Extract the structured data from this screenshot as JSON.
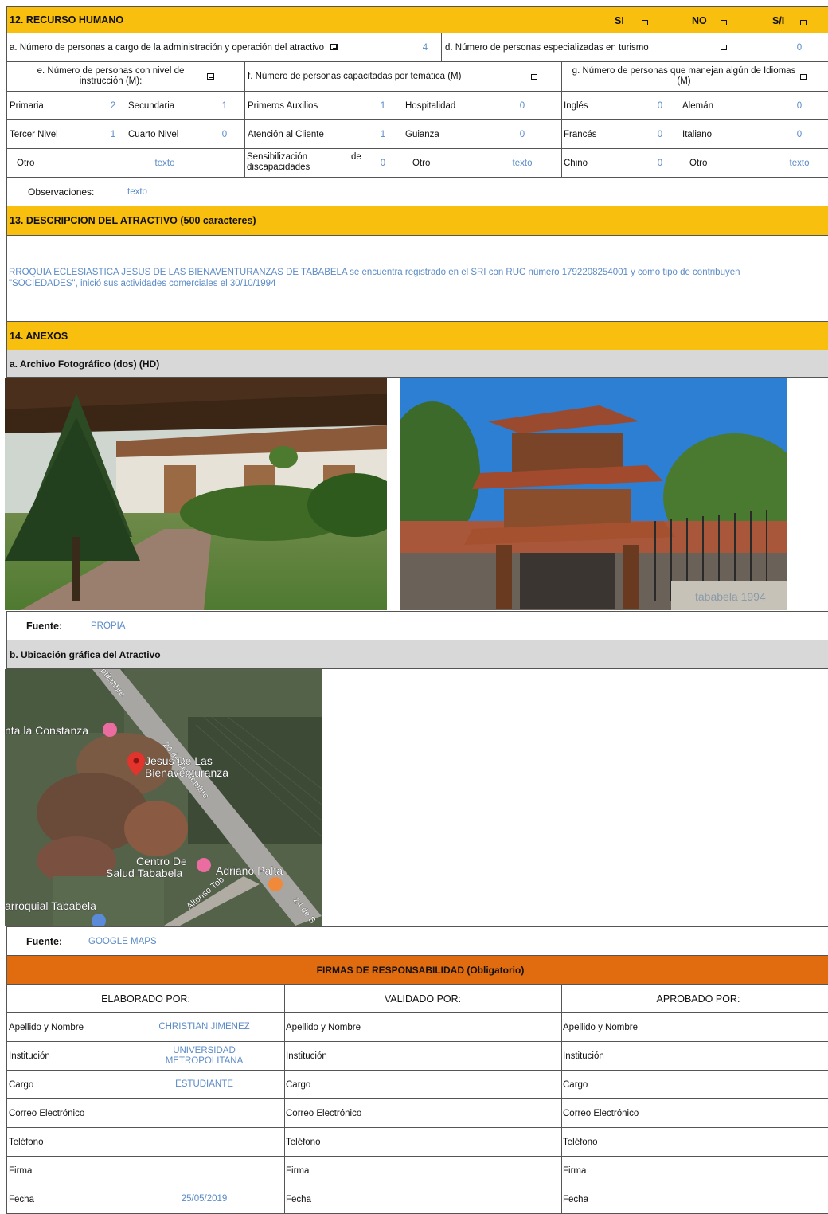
{
  "s12": {
    "title": "12. RECURSO HUMANO",
    "si": "SI",
    "no": "NO",
    "si_na": "S/I",
    "a_label": "a. Número de personas a cargo de la administración y operación del atractivo",
    "a_value": "4",
    "d_label": "d. Número de personas especializadas en turismo",
    "d_value": "0",
    "e_label": "e. Número de personas con nivel de instrucción (M):",
    "f_label": "f. Número de personas capacitadas por temática (M)",
    "g_label": "g. Número de personas que manejan algún de Idiomas (M)",
    "rows": [
      [
        [
          "Primaria",
          "2"
        ],
        [
          "Secundaria",
          "1"
        ],
        [
          "Primeros Auxilios",
          "1"
        ],
        [
          "Hospitalidad",
          "0"
        ],
        [
          "Inglés",
          "0"
        ],
        [
          "Alemán",
          "0"
        ]
      ],
      [
        [
          "Tercer Nivel",
          "1"
        ],
        [
          "Cuarto Nivel",
          "0"
        ],
        [
          "Atención al Cliente",
          "1"
        ],
        [
          "Guianza",
          "0"
        ],
        [
          "Francés",
          "0"
        ],
        [
          "Italiano",
          "0"
        ]
      ]
    ],
    "row3": {
      "otro1": "Otro",
      "otro1_val": "texto",
      "sens_a": "Sensibilización",
      "sens_de": "de",
      "sens_b": "discapacidades",
      "sens_val": "0",
      "otro2": "Otro",
      "otro2_val": "texto",
      "chino": "Chino",
      "chino_val": "0",
      "otro3": "Otro",
      "otro3_val": "texto"
    },
    "obs_label": "Observaciones:",
    "obs_value": "texto"
  },
  "s13": {
    "title": "13. DESCRIPCION DEL ATRACTIVO (500 caracteres)",
    "line1": "RROQUIA ECLESIASTICA JESUS DE LAS BIENAVENTURANZAS DE TABABELA se encuentra registrado en el SRI con RUC número 1792208254001 y como tipo de contribuyen",
    "line2": "\"SOCIEDADES\", inició sus actividades comerciales el 30/10/1994"
  },
  "s14": {
    "title": "14. ANEXOS",
    "a_title": "a. Archivo Fotográfico (dos) (HD)",
    "fuente_label": "Fuente:",
    "fuente_a": "PROPIA",
    "b_title": "b. Ubicación gráfica del Atractivo",
    "fuente_b": "GOOGLE MAPS",
    "map_labels": {
      "street_top": "ptiembre",
      "quinta": "nta la Constanza",
      "pin1": "Jesus De Las",
      "pin2": "Bienaventuranza",
      "street_mid": "24 de Septiembre",
      "centro1": "Centro De",
      "centro2": "Salud Tababela",
      "adriano": "Adriano Palta",
      "alfonso": "Alfonso Tob",
      "parroquial": "arroquial Tababela",
      "street_corner": "24 de S"
    },
    "sign_text": "tababela 1994"
  },
  "firmas": {
    "title": "FIRMAS DE RESPONSABILIDAD (Obligatorio)",
    "cols": [
      "ELABORADO POR:",
      "VALIDADO  POR:",
      "APROBADO POR:"
    ],
    "rows": [
      "Apellido y Nombre",
      "Institución",
      "Cargo",
      "Correo Electrónico",
      "Teléfono",
      "Firma",
      "Fecha"
    ],
    "elaborado": {
      "nombre": "CHRISTIAN JIMENEZ",
      "institucion1": "UNIVERSIDAD",
      "institucion2": "METROPOLITANA",
      "cargo": "ESTUDIANTE",
      "fecha": "25/05/2019"
    }
  },
  "colors": {
    "header_yellow": "#f9bf0e",
    "header_orange": "#e06c0f",
    "value_blue": "#5b8bc7",
    "subheader_grey": "#d8d8d8"
  }
}
